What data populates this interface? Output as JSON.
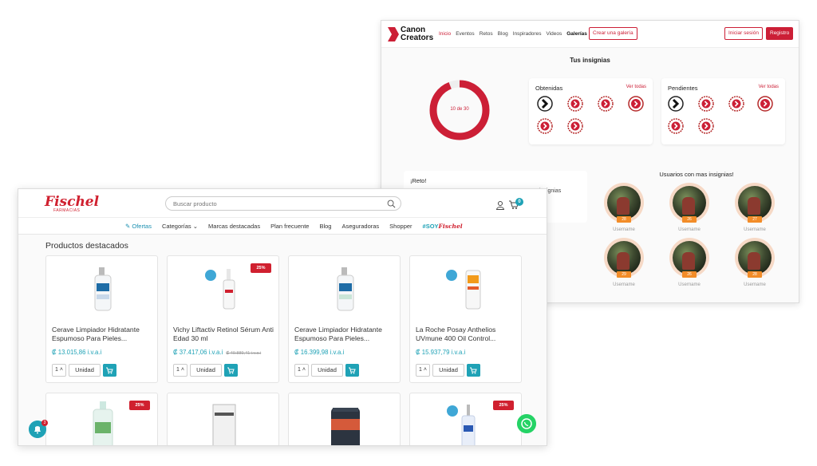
{
  "canon": {
    "logo_line1": "Canon",
    "logo_line2": "Creators",
    "nav": [
      "Inicio",
      "Eventos",
      "Retos",
      "Blog",
      "Inspiradores",
      "Videos",
      "Galerías"
    ],
    "create_gallery": "Crear una galería",
    "login": "Iniciar sesión",
    "register": "Registro",
    "section_title": "Tus insignias",
    "progress_label": "10 de 30",
    "progress_fraction": 0.94,
    "earned_title": "Obtenidas",
    "pending_title": "Pendientes",
    "see_all": "Ver todas",
    "reto_title": "¡Reto!",
    "reto_text": "insignias",
    "users_title": "Usuarios con mas insignias!",
    "users": [
      {
        "name": "Username",
        "score": "28"
      },
      {
        "name": "Username",
        "score": "26"
      },
      {
        "name": "Username",
        "score": "27"
      },
      {
        "name": "Username",
        "score": "29"
      },
      {
        "name": "Username",
        "score": "26"
      },
      {
        "name": "Username",
        "score": "28"
      }
    ],
    "accent": "#cc1f36"
  },
  "fischel": {
    "brand": "Fischel",
    "brand_sub": "FARMACIAS",
    "search_placeholder": "Buscar producto",
    "cart_count": "0",
    "menu": {
      "offers": "Ofertas",
      "categories": "Categorías",
      "brands": "Marcas destacadas",
      "frequent": "Plan frecuente",
      "blog": "Blog",
      "insurers": "Aseguradoras",
      "shopper": "Shopper",
      "soy_prefix": "#SOY",
      "soy_brand": "Fischel"
    },
    "heading": "Productos destacados",
    "products": [
      {
        "name": "Cerave Limpiador Hidratante Espumoso Para Pieles...",
        "price": "₡ 13.015,86 i.v.a.i",
        "old": "",
        "discount": "",
        "qty": "1",
        "unit": "Unidad"
      },
      {
        "name": "Vichy Liftactiv Retinol Sérum Anti Edad 30 ml",
        "price": "₡ 37.417,06 i.v.a.i",
        "old": "₡ 49.889,41 i.v.a.i",
        "discount": "25%",
        "qty": "1",
        "unit": "Unidad"
      },
      {
        "name": "Cerave Limpiador Hidratante Espumoso Para Pieles...",
        "price": "₡ 16.399,98 i.v.a.i",
        "old": "",
        "discount": "",
        "qty": "1",
        "unit": "Unidad"
      },
      {
        "name": "La Roche Posay Anthelios UVmune 400 Oil Control...",
        "price": "₡ 15.937,79 i.v.a.i",
        "old": "",
        "discount": "",
        "qty": "1",
        "unit": "Unidad"
      }
    ],
    "products_row2": [
      {
        "discount": "25%"
      },
      {
        "discount": ""
      },
      {
        "discount": ""
      },
      {
        "discount": "25%"
      }
    ],
    "notification_count": "3",
    "accent": "#1fa2b6",
    "brand_color": "#d0202f"
  }
}
